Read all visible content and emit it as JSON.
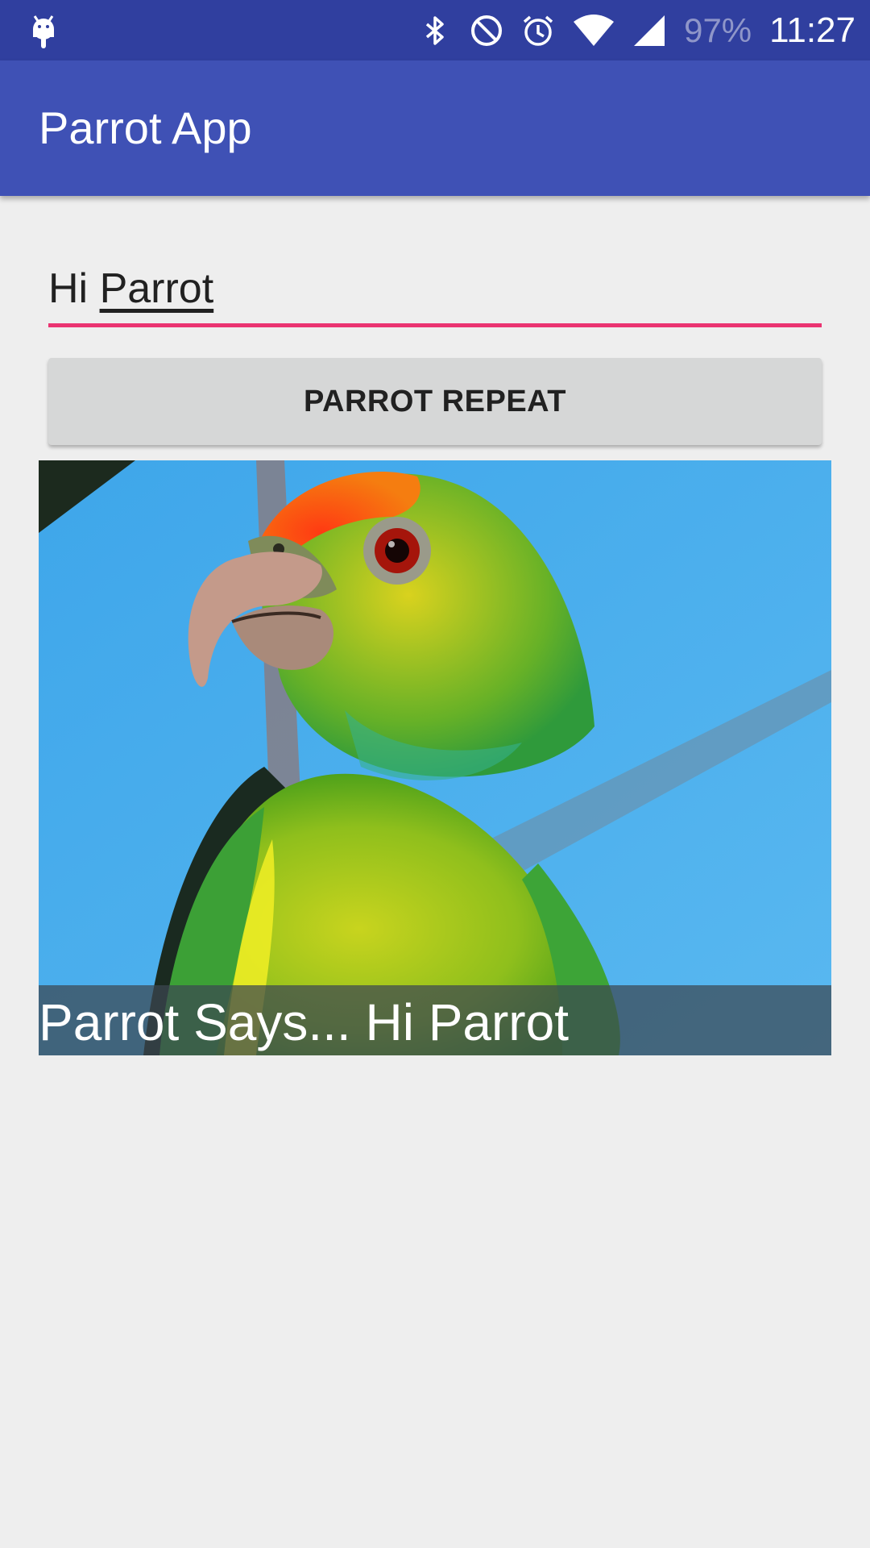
{
  "status_bar": {
    "battery": "97%",
    "time": "11:27",
    "icons": [
      "android-debug-icon",
      "bluetooth-icon",
      "do-not-disturb-icon",
      "alarm-icon",
      "wifi-icon",
      "cellular-signal-icon"
    ]
  },
  "toolbar": {
    "title": "Parrot App",
    "background_color": "#3f51b5"
  },
  "input": {
    "value_word1": "Hi ",
    "value_word2": "Parrot",
    "underline_color": "#e91e63"
  },
  "button": {
    "label": "PARROT REPEAT"
  },
  "image": {
    "subject": "parrot-photo",
    "caption": "Parrot Says... Hi Parrot"
  }
}
